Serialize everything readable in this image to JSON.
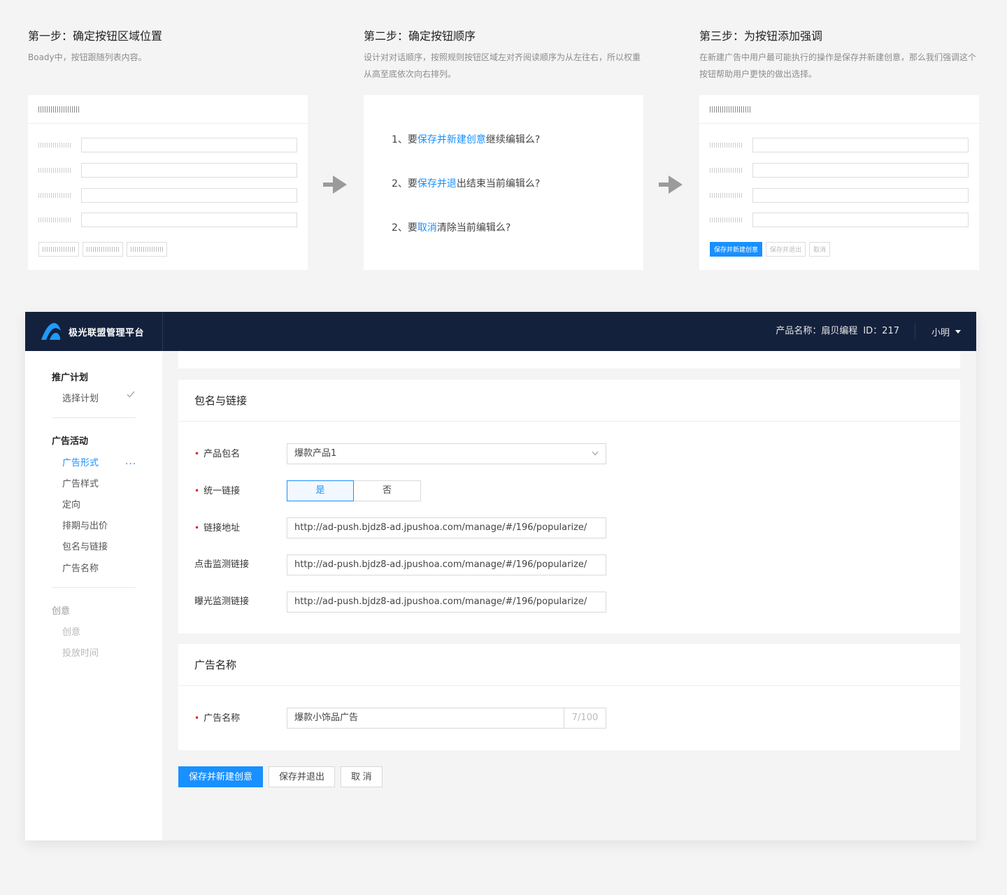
{
  "steps": [
    {
      "title": "第一步：确定按钮区域位置",
      "desc": "Boady中，按钮跟随列表内容。"
    },
    {
      "title": "第二步：确定按钮顺序",
      "desc": "设计对对话顺序，按照规则按钮区域左对齐阅读顺序为从左往右，所以权重从高至底依次向右排列。"
    },
    {
      "title": "第三步：为按钮添加强调",
      "desc": "在新建广告中用户最可能执行的操作是保存并新建创意，那么我们强调这个按钮帮助用户更快的做出选择。"
    }
  ],
  "questions": [
    {
      "prefix": "1、要",
      "highlight": "保存并新建创意",
      "suffix": "继续编辑么?"
    },
    {
      "prefix": "2、要",
      "highlight": "保存并退",
      "suffix": "出结束当前编辑么?"
    },
    {
      "prefix": "2、要",
      "highlight": "取消",
      "suffix": "清除当前编辑么?"
    }
  ],
  "mini_buttons": [
    "保存并新建创意",
    "保存并退出",
    "取消"
  ],
  "app": {
    "brand": "极光联盟管理平台",
    "product_label": "产品名称：扇贝编程",
    "product_id": "ID：217",
    "user": "小明"
  },
  "sidebar": {
    "groups": [
      {
        "label": "推广计划",
        "items": [
          "选择计划"
        ]
      },
      {
        "label": "广告活动",
        "items": [
          "广告形式",
          "广告样式",
          "定向",
          "排期与出价",
          "包名与链接",
          "广告名称"
        ]
      },
      {
        "label": "创意",
        "items": [
          "创意",
          "投放时间"
        ]
      }
    ],
    "active_item": "广告形式"
  },
  "package_panel": {
    "title": "包名与链接",
    "fields": [
      {
        "label": "产品包名",
        "required": true,
        "value": "爆款产品1"
      },
      {
        "label": "统一链接",
        "required": true,
        "options": [
          "是",
          "否"
        ],
        "selected": "是"
      },
      {
        "label": "链接地址",
        "required": true,
        "value": "http://ad-push.bjdz8-ad.jpushoa.com/manage/#/196/popularize/"
      },
      {
        "label": "点击监测链接",
        "required": false,
        "value": "http://ad-push.bjdz8-ad.jpushoa.com/manage/#/196/popularize/"
      },
      {
        "label": "曝光监测链接",
        "required": false,
        "value": "http://ad-push.bjdz8-ad.jpushoa.com/manage/#/196/popularize/"
      }
    ]
  },
  "adname_panel": {
    "title": "广告名称",
    "label": "广告名称",
    "value": "爆款小饰品广告",
    "counter": "7/100"
  },
  "actions": {
    "save_new": "保存并新建创意",
    "save_exit": "保存并退出",
    "cancel": "取 消"
  },
  "colors": {
    "primary": "#1890ff",
    "topbar": "#14213d",
    "required": "#e02020"
  }
}
